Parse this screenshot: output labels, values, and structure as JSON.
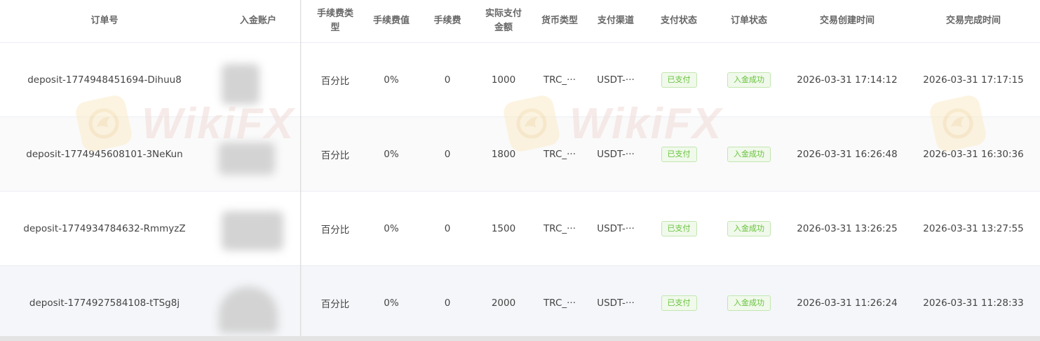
{
  "columns": [
    {
      "key": "order_no",
      "label": "订单号"
    },
    {
      "key": "account",
      "label": "入金账户"
    },
    {
      "key": "fee_type",
      "label_lines": [
        "手续费类",
        "型"
      ]
    },
    {
      "key": "fee_value",
      "label": "手续费值"
    },
    {
      "key": "fee",
      "label": "手续费"
    },
    {
      "key": "actual_amount",
      "label_lines": [
        "实际支付",
        "金额"
      ]
    },
    {
      "key": "currency",
      "label": "货币类型"
    },
    {
      "key": "channel",
      "label": "支付渠道"
    },
    {
      "key": "pay_status",
      "label": "支付状态"
    },
    {
      "key": "order_status",
      "label": "订单状态"
    },
    {
      "key": "created_at",
      "label": "交易创建时间"
    },
    {
      "key": "completed_at",
      "label": "交易完成时间"
    }
  ],
  "rows": [
    {
      "order_no": "deposit-1774948451694-Dihuu8",
      "fee_type": "百分比",
      "fee_value": "0%",
      "fee": "0",
      "actual_amount": "1000",
      "currency": "TRC_···",
      "channel": "USDT-···",
      "pay_status": "已支付",
      "order_status": "入金成功",
      "created_at": "2026-03-31 17:14:12",
      "completed_at": "2026-03-31 17:17:15"
    },
    {
      "order_no": "deposit-1774945608101-3NeKun",
      "fee_type": "百分比",
      "fee_value": "0%",
      "fee": "0",
      "actual_amount": "1800",
      "currency": "TRC_···",
      "channel": "USDT-···",
      "pay_status": "已支付",
      "order_status": "入金成功",
      "created_at": "2026-03-31 16:26:48",
      "completed_at": "2026-03-31 16:30:36"
    },
    {
      "order_no": "deposit-1774934784632-RmmyzZ",
      "fee_type": "百分比",
      "fee_value": "0%",
      "fee": "0",
      "actual_amount": "1500",
      "currency": "TRC_···",
      "channel": "USDT-···",
      "pay_status": "已支付",
      "order_status": "入金成功",
      "created_at": "2026-03-31 13:26:25",
      "completed_at": "2026-03-31 13:27:55"
    },
    {
      "order_no": "deposit-1774927584108-tTSg8j",
      "fee_type": "百分比",
      "fee_value": "0%",
      "fee": "0",
      "actual_amount": "2000",
      "currency": "TRC_···",
      "channel": "USDT-···",
      "pay_status": "已支付",
      "order_status": "入金成功",
      "created_at": "2026-03-31 11:26:24",
      "completed_at": "2026-03-31 11:28:33"
    }
  ],
  "watermark": {
    "text": "WikiFX",
    "icon": "wikifx-eagle-logo"
  },
  "colors": {
    "tag_paid_bg": "#f0f9eb",
    "tag_paid_border": "#c2e7b0",
    "tag_paid_text": "#67c23a",
    "row_alt_bg": "#fafafa",
    "row_last_bg": "#f4f6f9",
    "header_text": "#666666"
  }
}
